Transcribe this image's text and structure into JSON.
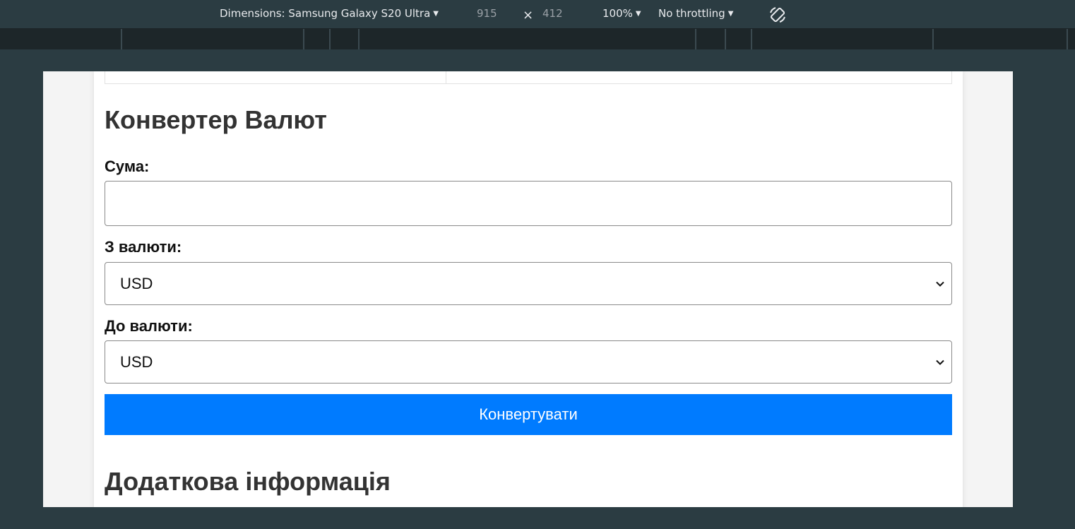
{
  "devtools": {
    "dimensions_label": "Dimensions: Samsung Galaxy S20 Ultra",
    "width": "915",
    "times": "×",
    "height": "412",
    "zoom": "100%",
    "throttling": "No throttling",
    "caret": "▼",
    "icons": [
      "chevron-down-icon",
      "rotate-icon"
    ]
  },
  "page": {
    "converter_title": "Конвертер Валют",
    "amount_label": "Сума:",
    "amount_value": "",
    "from_label": "З валюти:",
    "from_value": "USD",
    "to_label": "До валюти:",
    "to_value": "USD",
    "convert_button": "Конвертувати",
    "additional_title": "Додаткова інформація"
  },
  "colors": {
    "toolbar_bg": "#2b3c42",
    "ruler_bg": "#1d2629",
    "page_bg": "#f4f4f4",
    "card_bg": "#ffffff",
    "button_bg": "#007bff",
    "button_text": "#ffffff",
    "heading": "#333333"
  }
}
